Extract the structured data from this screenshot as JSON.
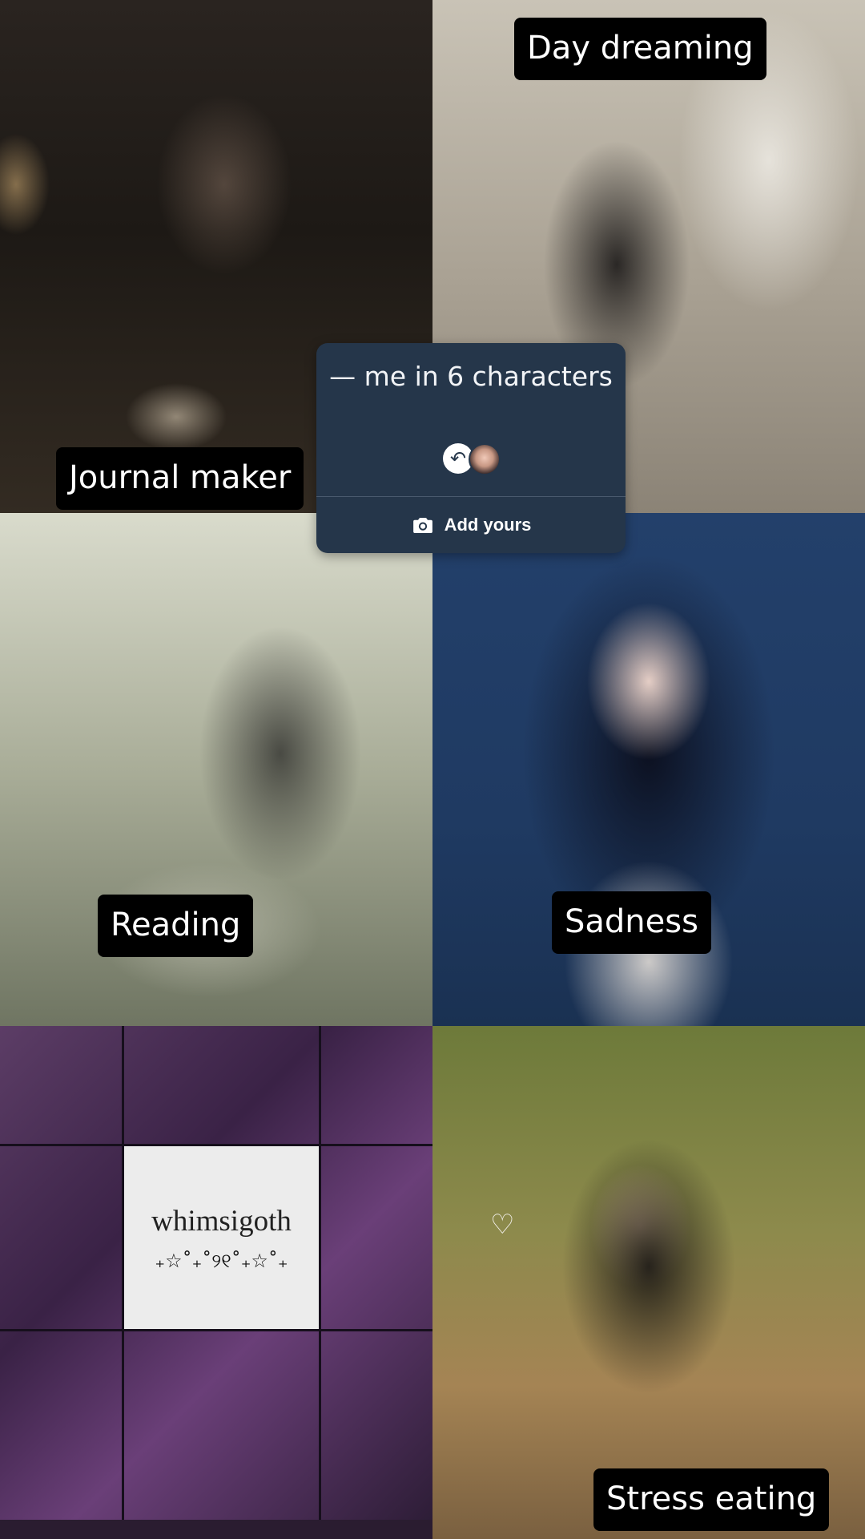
{
  "story_card": {
    "title": "— me in 6 characters",
    "reply_icon": "reply-arrow-icon",
    "action_icon": "camera-icon",
    "action_label": "Add yours"
  },
  "tiles": {
    "journal": {
      "label": "Journal maker"
    },
    "day": {
      "label": "Day dreaming"
    },
    "reading": {
      "label": "Reading"
    },
    "sadness": {
      "label": "Sadness"
    },
    "whimsigoth": {
      "title": "whimsigoth",
      "deco": "₊☆˚₊˚୨୧˚₊☆˚₊"
    },
    "stress": {
      "label": "Stress eating",
      "sticker_icon": "heart-outline-icon"
    }
  },
  "colors": {
    "card_background": "#25364a",
    "label_background": "#000000",
    "label_text": "#ffffff"
  }
}
